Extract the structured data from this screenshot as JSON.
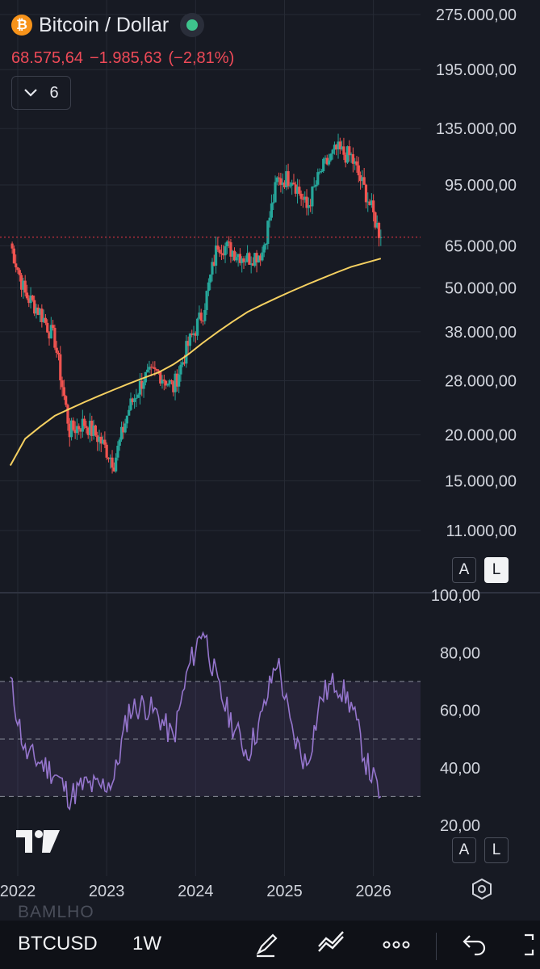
{
  "header": {
    "title": "Bitcoin / Dollar",
    "logo_glyph": "₿",
    "price": "68.575,64",
    "change": "−1.985,63",
    "change_pct": "(−2,81%)",
    "collapse_count": "6"
  },
  "price_axis": {
    "labels": [
      "275.000,00",
      "195.000,00",
      "135.000,00",
      "95.000,00",
      "65.000,00",
      "50.000,00",
      "38.000,00",
      "28.000,00",
      "20.000,00",
      "15.000,00",
      "11.000,00"
    ],
    "btn_auto": "A",
    "btn_log": "L"
  },
  "rsi_axis": {
    "labels": [
      "100,00",
      "80,00",
      "60,00",
      "40,00",
      "20,00"
    ],
    "btn_auto": "A",
    "btn_log": "L"
  },
  "time_axis": [
    "2022",
    "2023",
    "2024",
    "2025",
    "2026"
  ],
  "toolbar": {
    "symbol": "BTCUSD",
    "interval": "1W",
    "ghost_label": "BAMLHO",
    "icons": [
      "draw-icon",
      "indicators-icon",
      "more-icon",
      "undo-icon",
      "fullscreen-icon"
    ]
  },
  "colors": {
    "up": "#26a69a",
    "down": "#ef5350",
    "ma": "#f5d061",
    "rsi": "#9575cd",
    "price_line": "#f23645"
  },
  "chart_data": {
    "type": "candlestick",
    "scale": "log",
    "ylim": [
      10000,
      280000
    ],
    "x": [
      "2021-12",
      "2022-02",
      "2022-04",
      "2022-06",
      "2022-08",
      "2022-10",
      "2022-12",
      "2023-02",
      "2023-04",
      "2023-06",
      "2023-08",
      "2023-10",
      "2023-12",
      "2024-02",
      "2024-04",
      "2024-06",
      "2024-08",
      "2024-10",
      "2024-12",
      "2025-02",
      "2025-04",
      "2025-06",
      "2025-08",
      "2025-10",
      "2025-12",
      "2026-02"
    ],
    "close": [
      66000,
      48000,
      43000,
      36000,
      20500,
      21500,
      19500,
      16800,
      23500,
      28500,
      29500,
      26800,
      35000,
      43000,
      66000,
      63000,
      60000,
      62500,
      97000,
      100000,
      82000,
      104000,
      118000,
      113000,
      90000,
      68575
    ],
    "ma200": [
      16500,
      19500,
      21000,
      22500,
      23500,
      24500,
      25500,
      26500,
      27500,
      28500,
      29500,
      31000,
      33000,
      35500,
      38000,
      40500,
      43000,
      45000,
      47000,
      49000,
      51000,
      53000,
      55000,
      57000,
      58500,
      60000
    ],
    "last_price": 68575.64,
    "rsi": {
      "x": [
        "2021-12",
        "2022-02",
        "2022-04",
        "2022-06",
        "2022-08",
        "2022-10",
        "2022-12",
        "2023-02",
        "2023-04",
        "2023-06",
        "2023-08",
        "2023-10",
        "2023-12",
        "2024-02",
        "2024-04",
        "2024-06",
        "2024-08",
        "2024-10",
        "2024-12",
        "2025-02",
        "2025-04",
        "2025-06",
        "2025-08",
        "2025-10",
        "2025-12",
        "2026-02"
      ],
      "values": [
        70,
        45,
        42,
        38,
        30,
        34,
        33,
        36,
        60,
        62,
        58,
        50,
        74,
        89,
        68,
        55,
        45,
        58,
        78,
        52,
        41,
        65,
        70,
        62,
        42,
        30
      ],
      "ylim": [
        20,
        100
      ],
      "bands": [
        30,
        70
      ]
    }
  }
}
